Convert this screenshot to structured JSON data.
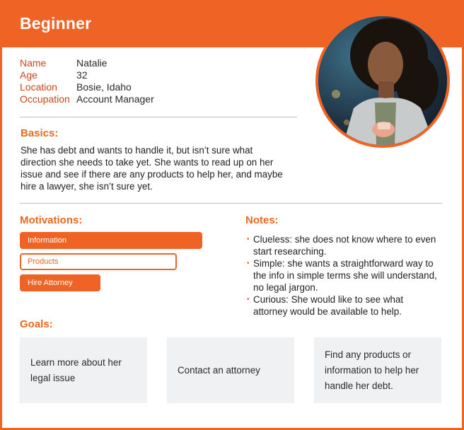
{
  "header": {
    "title": "Beginner"
  },
  "profile": [
    {
      "label": "Name",
      "value": "Natalie"
    },
    {
      "label": "Age",
      "value": "32"
    },
    {
      "label": "Location",
      "value": "Bosie, Idaho"
    },
    {
      "label": "Occupation",
      "value": "Account Manager"
    }
  ],
  "basics": {
    "title": "Basics:",
    "text": "She has debt and wants to handle it, but isn’t sure what direction she needs to take yet. She wants to read up on her issue and see if there are any products to help her, and maybe hire a lawyer, she isn’t sure yet."
  },
  "motivations": {
    "title": "Motivations:",
    "items": [
      {
        "label": "Information",
        "level": 1.0
      },
      {
        "label": "Products",
        "level": 0.86
      },
      {
        "label": "Hire Attorney",
        "level": 0.5
      }
    ]
  },
  "notes": {
    "title": "Notes:",
    "items": [
      "Clueless: she does not know where to even start researching.",
      "Simple: she wants a straightforward way to the info in simple terms she will understand, no legal jargon.",
      "Curious: She would like to see what attorney would be available to help."
    ]
  },
  "goals": {
    "title": "Goals:",
    "items": [
      "Learn more about her legal issue",
      "Contact an attorney",
      "Find any products or information to help her handle her debt."
    ]
  },
  "colors": {
    "accent": "#ef6424",
    "label": "#c9461b",
    "goal_bg": "#f0f1f3"
  }
}
